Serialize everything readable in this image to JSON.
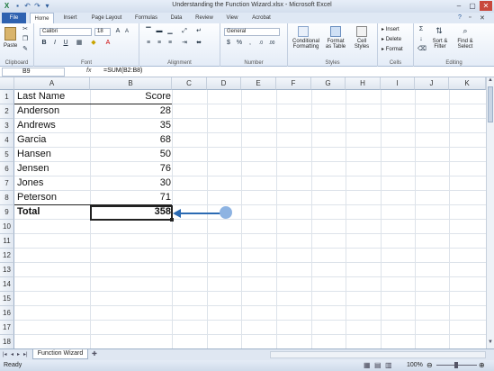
{
  "window": {
    "title": "Understanding the Function Wizard.xlsx - Microsoft Excel",
    "minimize": "–",
    "maximize": "▢",
    "close": "✕"
  },
  "quick_access": {
    "save_icon": "save-icon",
    "undo_icon": "undo-icon",
    "redo_icon": "redo-icon"
  },
  "tabs": [
    "File",
    "Home",
    "Insert",
    "Page Layout",
    "Formulas",
    "Data",
    "Review",
    "View",
    "Acrobat"
  ],
  "ribbon": {
    "clipboard": {
      "label": "Clipboard",
      "paste": "Paste"
    },
    "font": {
      "label": "Font",
      "name": "Calibri",
      "size": "18",
      "bold": "B",
      "italic": "I",
      "underline": "U"
    },
    "alignment": {
      "label": "Alignment"
    },
    "number": {
      "label": "Number",
      "format": "General",
      "currency": "$",
      "percent": "%",
      "comma": ","
    },
    "styles": {
      "label": "Styles",
      "cond_format": "Conditional",
      "cond_format2": "Formatting",
      "format_table": "Format",
      "format_table2": "as Table",
      "cell_styles": "Cell",
      "cell_styles2": "Styles"
    },
    "cells": {
      "label": "Cells",
      "insert": "Insert",
      "delete": "Delete",
      "format": "Format"
    },
    "editing": {
      "label": "Editing",
      "sum": "Σ",
      "sort": "Sort &",
      "sort2": "Filter",
      "find": "Find &",
      "find2": "Select"
    }
  },
  "formula_bar": {
    "name_box": "B9",
    "fx": "fx",
    "formula": "=SUM(B2:B8)"
  },
  "columns": [
    "A",
    "B",
    "C",
    "D",
    "E",
    "F",
    "G",
    "H",
    "I",
    "J",
    "K"
  ],
  "rows": [
    "1",
    "2",
    "3",
    "4",
    "5",
    "6",
    "7",
    "8",
    "9",
    "10",
    "11",
    "12",
    "13",
    "14",
    "15",
    "16",
    "17",
    "18"
  ],
  "cells": {
    "a1": "Last Name",
    "b1": "Score",
    "a2": "Anderson",
    "b2": "28",
    "a3": "Andrews",
    "b3": "35",
    "a4": "Garcia",
    "b4": "68",
    "a5": "Hansen",
    "b5": "50",
    "a6": "Jensen",
    "b6": "76",
    "a7": "Jones",
    "b7": "30",
    "a8": "Peterson",
    "b8": "71",
    "a9": "Total",
    "b9": "358"
  },
  "sheet_tab": "Function Wizard",
  "status": {
    "left": "Ready",
    "zoom": "100%"
  },
  "colors": {
    "accent": "#2f62b0",
    "callout": "#2a6ab3"
  }
}
